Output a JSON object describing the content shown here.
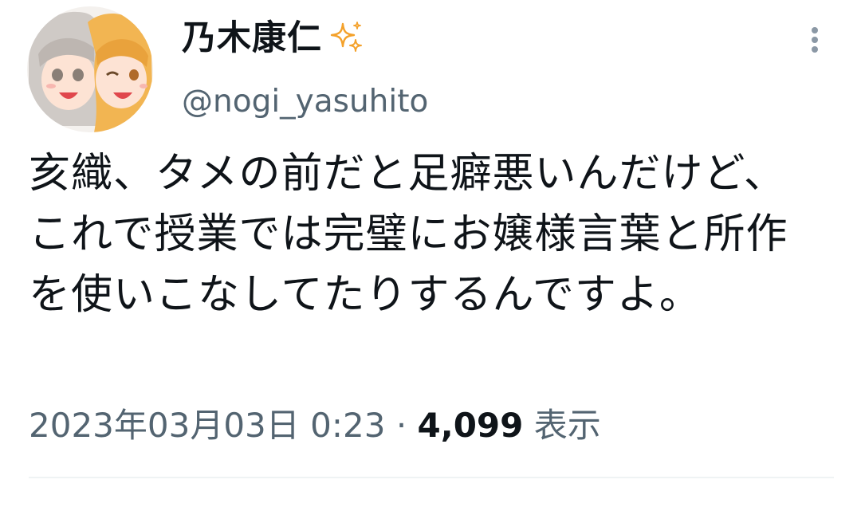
{
  "author": {
    "display_name": "乃木康仁",
    "handle": "@nogi_yasuhito",
    "badge_icon": "sparkle-icon"
  },
  "tweet": {
    "text": "亥織、タメの前だと足癖悪いんだけど、これで授業では完璧にお嬢様言葉と所作を使いこなしてたりするんですよ。",
    "date": "2023年03月03日 0:23",
    "separator": "·",
    "views_count": "4,099",
    "views_label": "表示"
  },
  "colors": {
    "text_primary": "#0f1419",
    "text_secondary": "#536471",
    "sparkle": "#f4a12a",
    "divider": "#eff3f4"
  }
}
